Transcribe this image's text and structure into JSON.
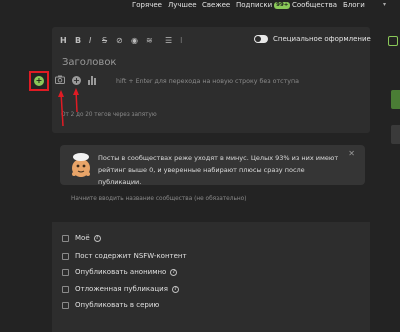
{
  "nav": {
    "items": [
      "Горячее",
      "Лучшее",
      "Свежее",
      "Подписки",
      "Сообщества",
      "Блоги"
    ],
    "subscriptions_badge": "99+"
  },
  "editor": {
    "toolbar_icons": [
      "heading-icon",
      "bold-icon",
      "italic-icon",
      "strikethrough-icon",
      "link-icon",
      "spoiler-icon",
      "hide-icon",
      "unordered-list-icon",
      "ordered-list-icon"
    ],
    "toolbar_glyphs": [
      "H",
      "B",
      "I",
      "S",
      "⊘",
      "◉",
      "≋",
      "☰",
      "⁝"
    ],
    "special_format_label": "Специальное оформление",
    "special_format_on": false,
    "title_placeholder": "Заголовок",
    "body_placeholder": "hift + Enter для перехода на новую строку без отступа",
    "tags_placeholder": "От 2 до 20 тегов через запятую"
  },
  "notice": {
    "text": "Посты в сообществах реже уходят в минус. Целых 93% из них имеют рейтинг выше 0, и уверенные набирают плюсы сразу после публикации."
  },
  "community_placeholder": "Начните вводить название сообщества (не обязательно)",
  "options": [
    {
      "label": "Моё",
      "help": true
    },
    {
      "label": "Пост содержит NSFW-контент",
      "help": false
    },
    {
      "label": "Опубликовать анонимно",
      "help": true
    },
    {
      "label": "Отложенная публикация",
      "help": true
    },
    {
      "label": "Опубликовать в серию",
      "help": false
    }
  ],
  "colors": {
    "accent": "#8ac858",
    "highlight": "#e01b24",
    "background": "#232323",
    "panel": "#2d2d2d"
  }
}
